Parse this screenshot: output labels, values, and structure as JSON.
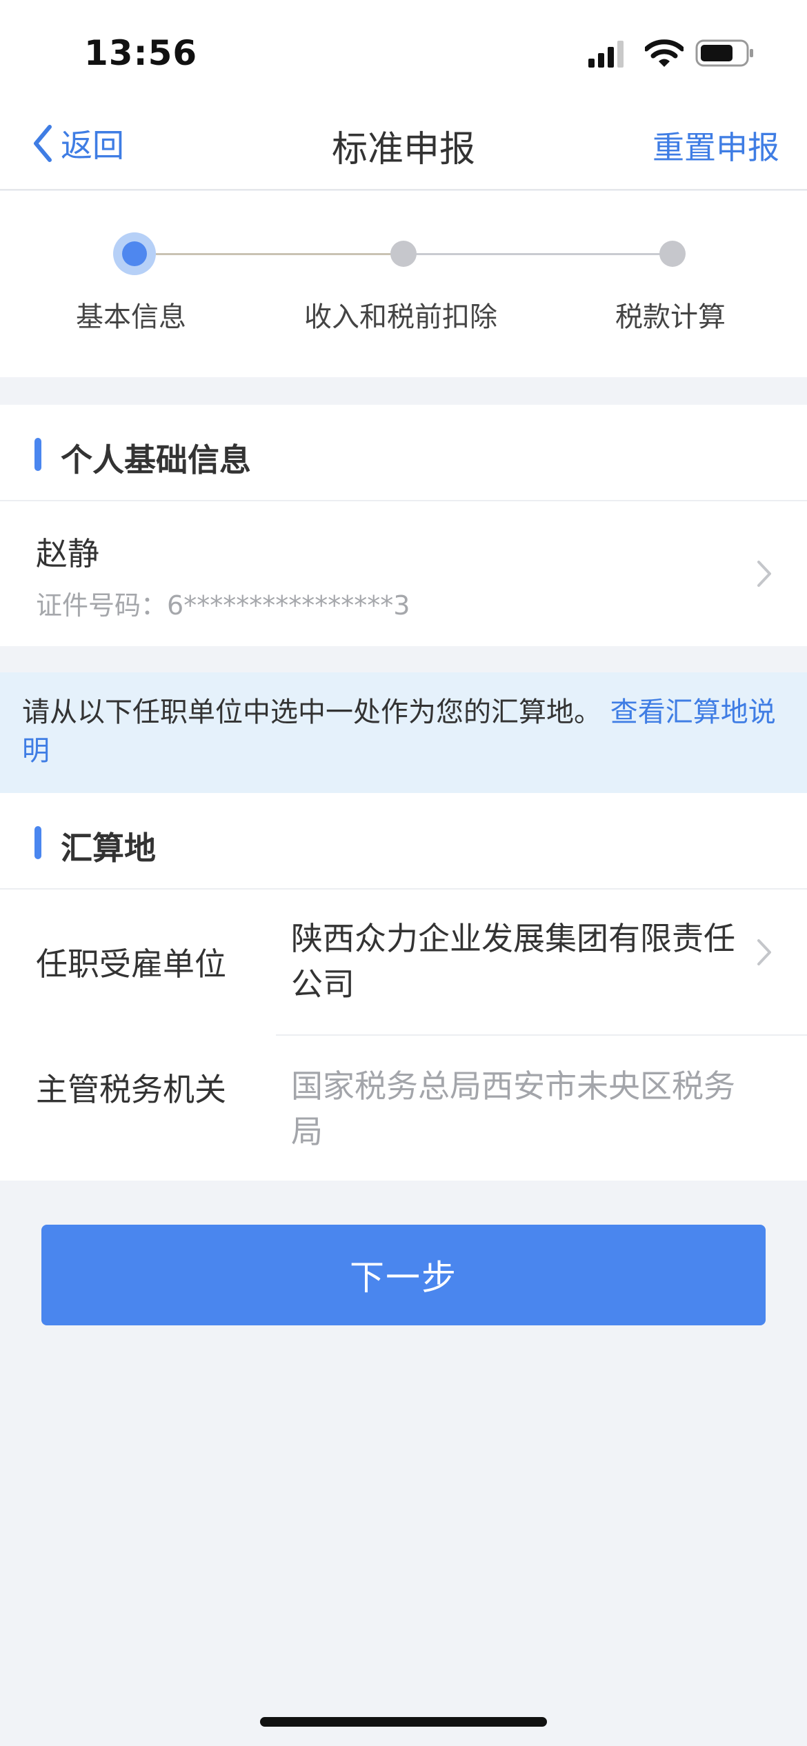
{
  "status_bar": {
    "time": "13:56"
  },
  "nav": {
    "back_label": "返回",
    "title": "标准申报",
    "reset_label": "重置申报"
  },
  "steps": [
    {
      "label": "基本信息",
      "state": "active"
    },
    {
      "label": "收入和税前扣除",
      "state": "pending"
    },
    {
      "label": "税款计算",
      "state": "pending"
    }
  ],
  "personal_section": {
    "title": "个人基础信息",
    "name": "赵静",
    "id_label": "证件号码：",
    "id_value": "6****************3"
  },
  "notice": {
    "text": "请从以下任职单位中选中一处作为您的汇算地。",
    "link": "查看汇算地说明"
  },
  "settlement_section": {
    "title": "汇算地",
    "employer_label": "任职受雇单位",
    "employer_value": "陕西众力企业发展集团有限责任公司",
    "tax_office_label": "主管税务机关",
    "tax_office_value": "国家税务总局西安市未央区税务局"
  },
  "next_button_label": "下一步",
  "colors": {
    "accent": "#4a86ee",
    "link": "#3f7de4",
    "notice_bg": "#e5f1fb",
    "page_bg": "#f1f3f7"
  },
  "icons": [
    "cellular-signal-icon",
    "wifi-icon",
    "battery-icon",
    "chevron-left-icon",
    "chevron-right-icon"
  ]
}
